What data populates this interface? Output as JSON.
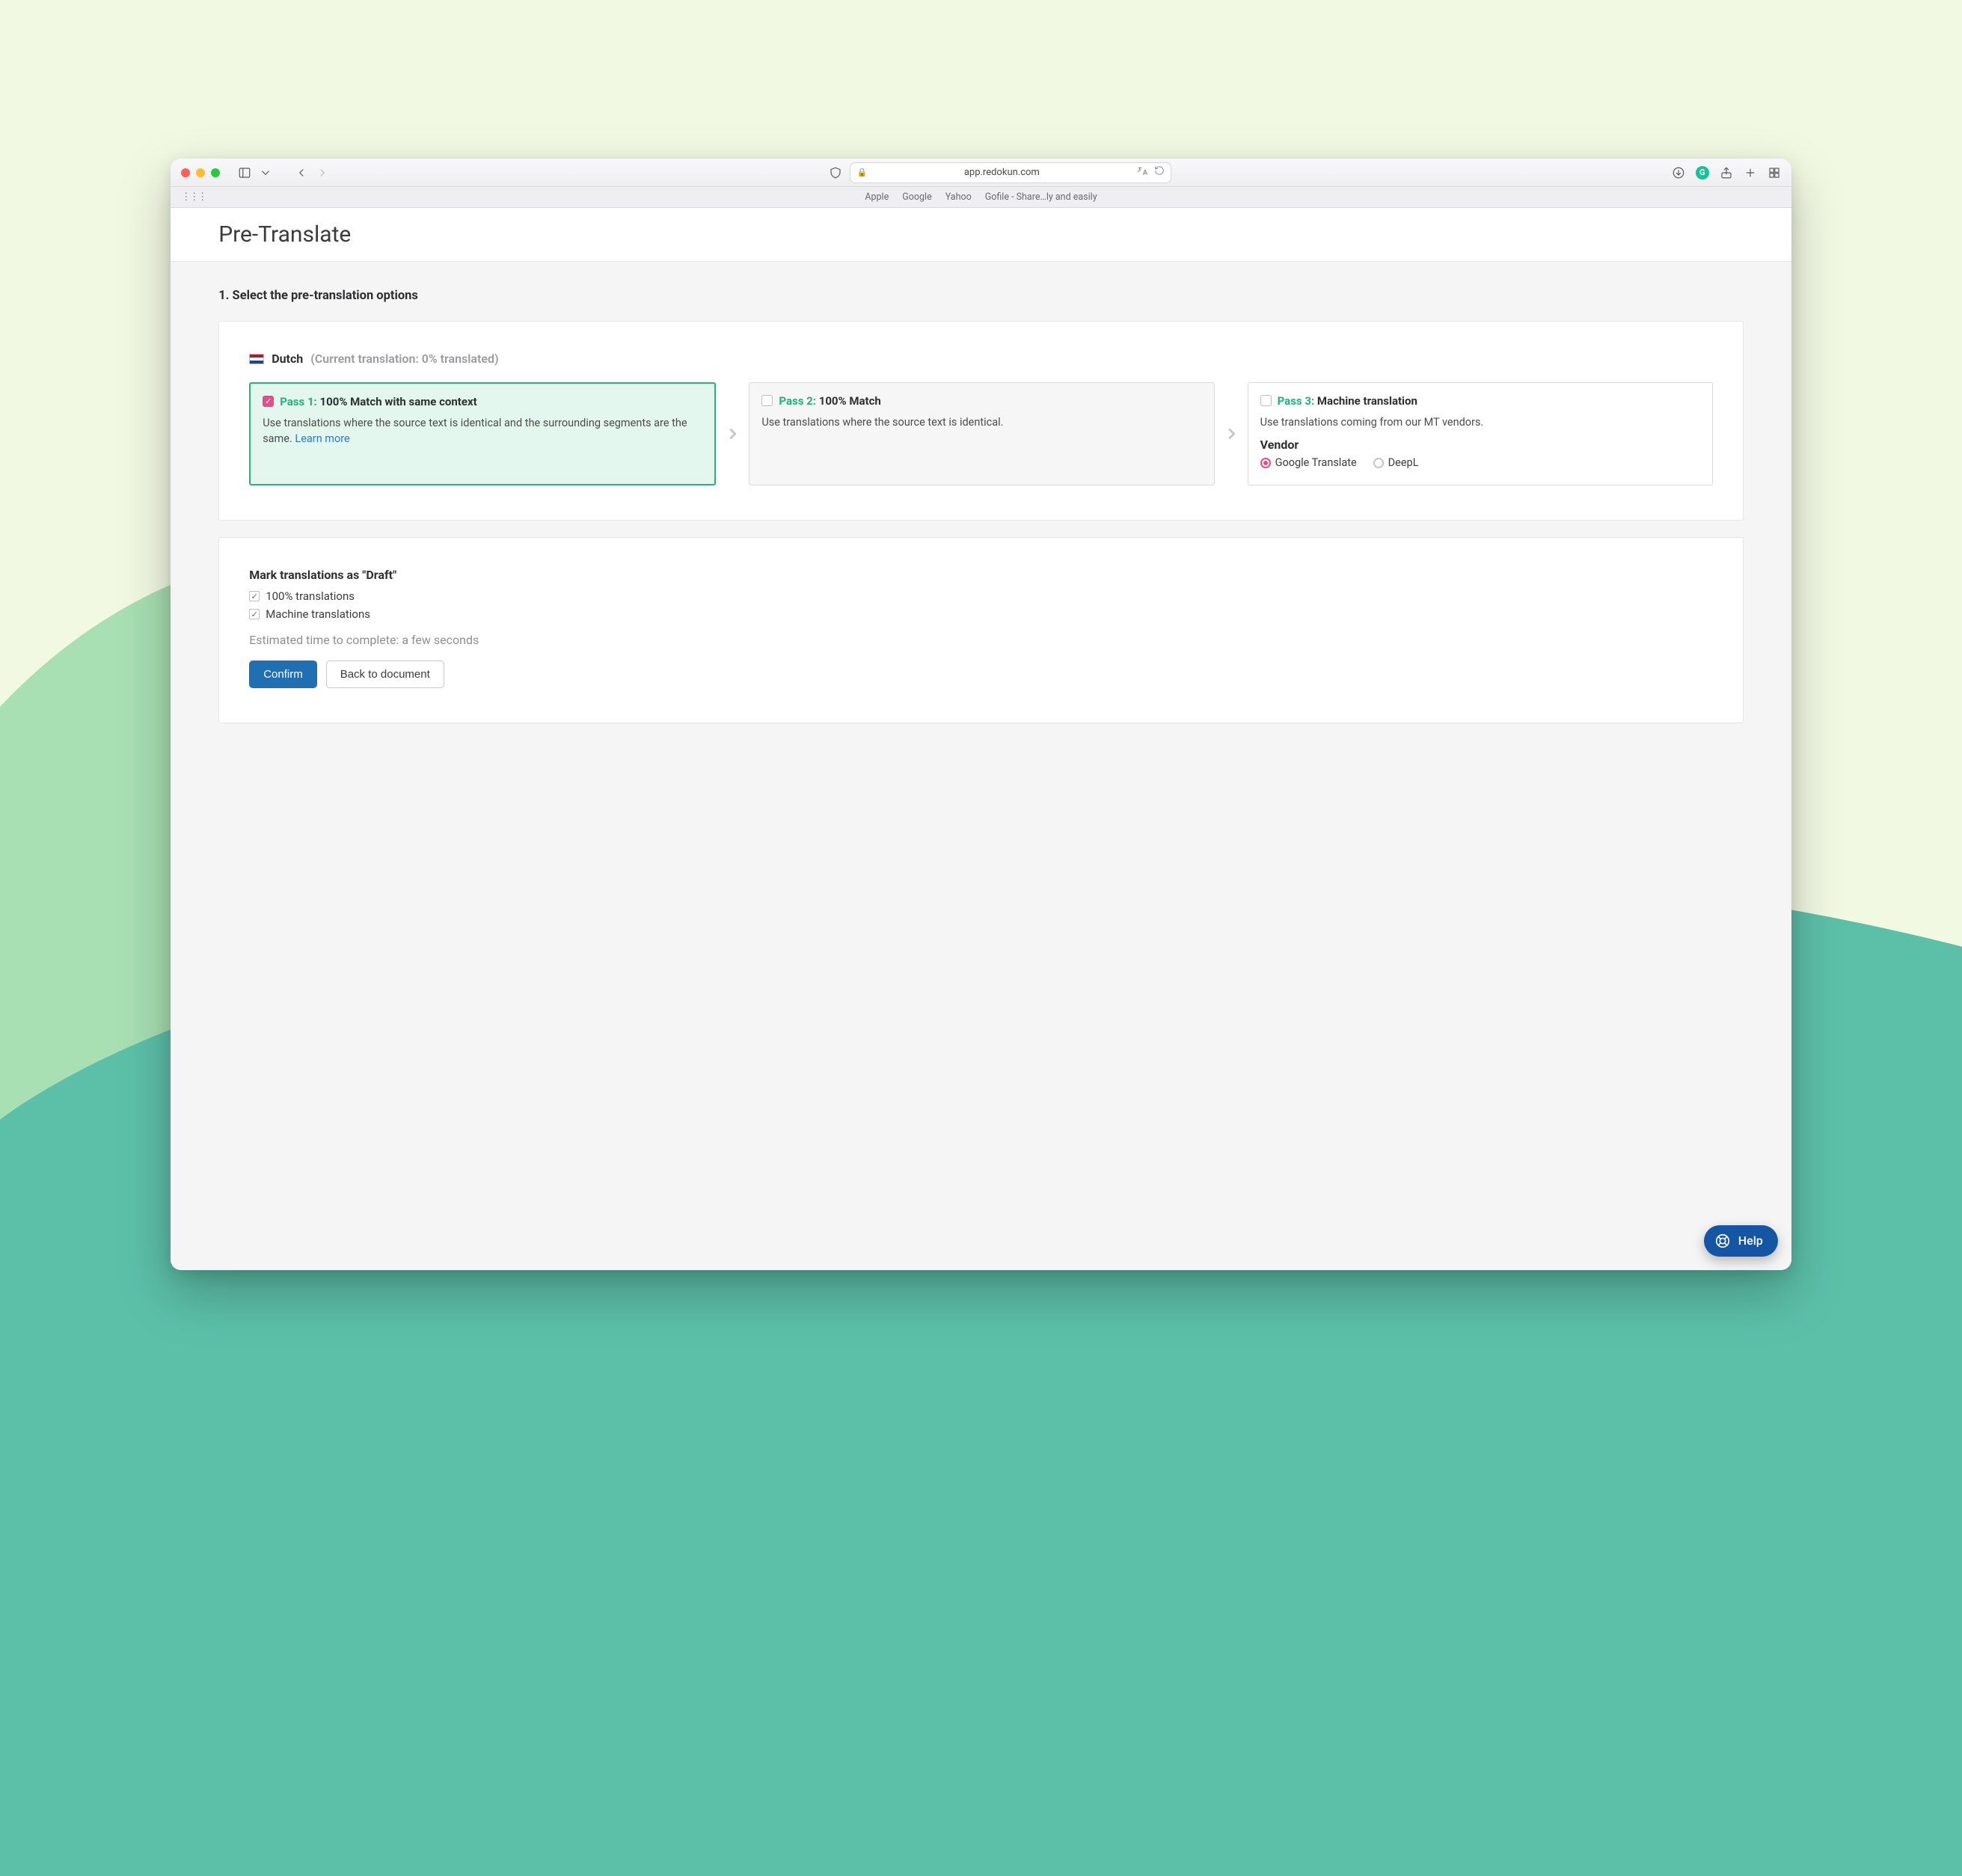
{
  "browser": {
    "address": "app.redokun.com",
    "bookmarks": [
      "Apple",
      "Google",
      "Yahoo",
      "Gofile - Share…ly and easily"
    ]
  },
  "page": {
    "title": "Pre-Translate",
    "step_title": "1. Select the pre-translation options",
    "language": {
      "name": "Dutch",
      "status": "(Current translation: 0% translated)"
    },
    "passes": [
      {
        "checked": true,
        "label": "Pass 1:",
        "title": "100% Match with same context",
        "desc": "Use translations where the source text is identical and the surrounding segments are the same. ",
        "learn_more": "Learn more"
      },
      {
        "checked": false,
        "label": "Pass 2:",
        "title": "100% Match",
        "desc": "Use translations where the source text is identical."
      },
      {
        "checked": false,
        "label": "Pass 3:",
        "title": "Machine translation",
        "desc": "Use translations coming from our MT vendors.",
        "vendor_label": "Vendor",
        "vendors": [
          {
            "name": "Google Translate",
            "selected": true
          },
          {
            "name": "DeepL",
            "selected": false
          }
        ]
      }
    ],
    "draft": {
      "title": "Mark translations as \"Draft\"",
      "options": [
        {
          "label": "100% translations",
          "checked": true
        },
        {
          "label": "Machine translations",
          "checked": true
        }
      ]
    },
    "eta": "Estimated time to complete: a few seconds",
    "buttons": {
      "confirm": "Confirm",
      "back": "Back to document"
    }
  },
  "help": {
    "label": "Help"
  }
}
